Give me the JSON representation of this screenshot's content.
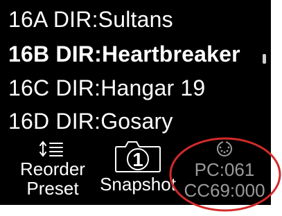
{
  "presets": [
    {
      "label": "16A DIR:Sultans",
      "selected": false
    },
    {
      "label": "16B DIR:Heartbreaker",
      "selected": true
    },
    {
      "label": "16C DIR:Hangar 19",
      "selected": false
    },
    {
      "label": "16D DIR:Gosary",
      "selected": false
    }
  ],
  "bottom": {
    "reorder": {
      "icon": "reorder-list-icon",
      "line1": "Reorder",
      "line2": "Preset"
    },
    "snapshot": {
      "icon": "camera-icon",
      "number": "1",
      "label": "Snapshot"
    },
    "midi": {
      "icon": "midi-din-icon",
      "pc": "PC:061",
      "cc": "CC69:000"
    }
  },
  "colors": {
    "background": "#000000",
    "text": "#ffffff",
    "dim_text": "#9a9a9a",
    "annotation": "#d42a2a"
  }
}
